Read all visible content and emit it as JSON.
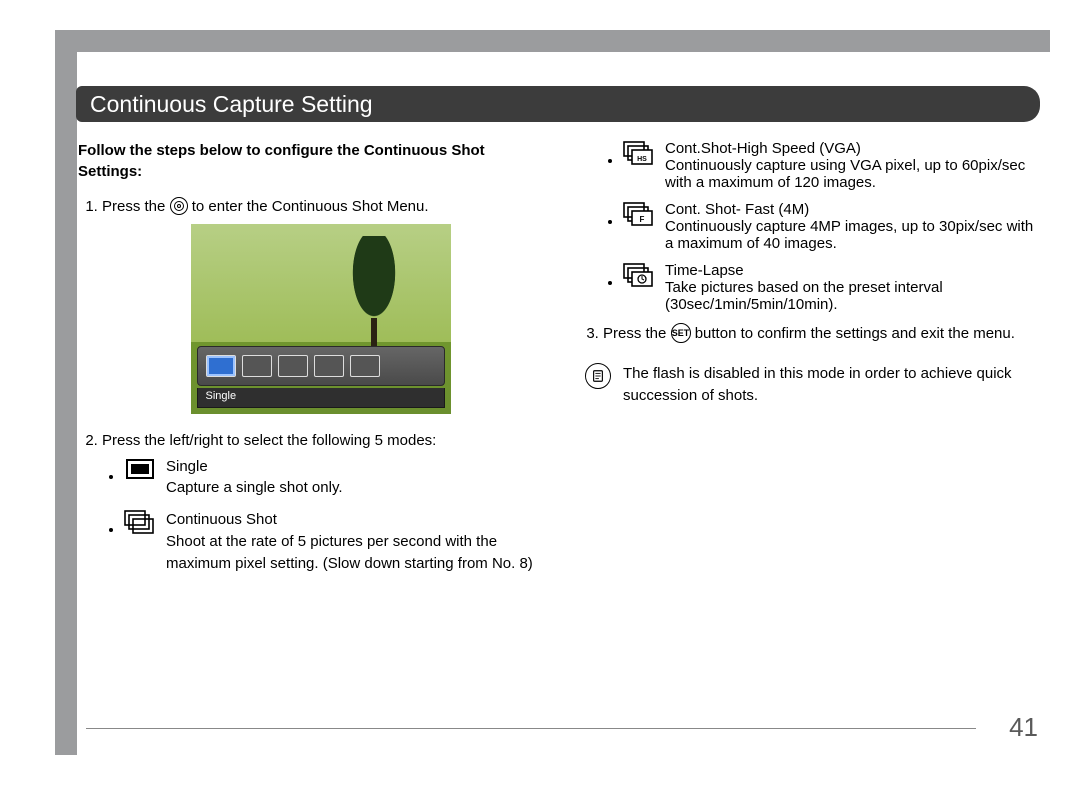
{
  "title": "Continuous Capture Setting",
  "intro": "Follow the steps below to configure the Continuous Shot Settings:",
  "step1_a": "Press the ",
  "step1_b": " to enter the Continuous Shot Menu.",
  "screenshot_label": "Single",
  "step2": "Press the left/right to select the following 5 modes:",
  "modes": {
    "single": {
      "name": "Single",
      "desc": "Capture a single shot only."
    },
    "cont": {
      "name": "Continuous Shot",
      "desc": "Shoot at the rate of 5 pictures per second with the maximum pixel setting. (Slow down starting from No. 8)"
    },
    "hs": {
      "name": "Cont.Shot-High Speed (VGA)",
      "desc": "Continuously capture using VGA pixel, up to 60pix/sec with a maximum of 120 images."
    },
    "fast": {
      "name": "Cont. Shot- Fast (4M)",
      "desc": "Continuously capture 4MP images, up to 30pix/sec with a maximum of 40 images."
    },
    "tl": {
      "name": "Time-Lapse",
      "desc": "Take pictures based on the preset interval (30sec/1min/5min/10min)."
    }
  },
  "step3_a": "Press the ",
  "step3_b": " button to confirm the settings and exit the menu.",
  "set_label": "SET",
  "note": "The flash is disabled in this mode in order to achieve quick succession of shots.",
  "page": "41"
}
